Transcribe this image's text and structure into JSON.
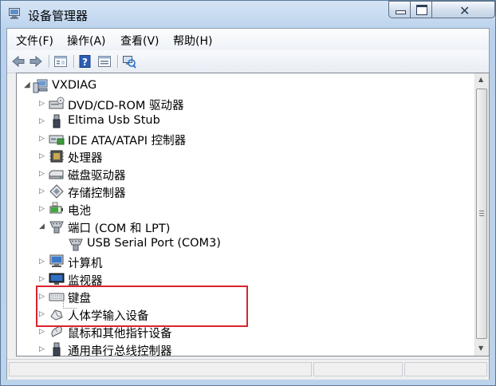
{
  "window": {
    "title": "设备管理器"
  },
  "menubar": {
    "items": [
      "文件(F)",
      "操作(A)",
      "查看(V)",
      "帮助(H)"
    ]
  },
  "toolbar": {
    "buttons": [
      "back-icon",
      "forward-icon",
      "properties-icon",
      "help-icon",
      "details-icon",
      "scan-hardware-icon"
    ]
  },
  "tree": {
    "root": "VXDIAG",
    "items": [
      {
        "label": "DVD/CD-ROM 驱动器",
        "icon": "dvd-drive-icon",
        "expanded": false
      },
      {
        "label": "Eltima Usb Stub",
        "icon": "usb-plug-icon",
        "expanded": false
      },
      {
        "label": "IDE ATA/ATAPI 控制器",
        "icon": "ide-controller-icon",
        "expanded": false
      },
      {
        "label": "处理器",
        "icon": "processor-icon",
        "expanded": false
      },
      {
        "label": "磁盘驱动器",
        "icon": "disk-drive-icon",
        "expanded": false
      },
      {
        "label": "存储控制器",
        "icon": "storage-controller-icon",
        "expanded": false
      },
      {
        "label": "电池",
        "icon": "battery-icon",
        "expanded": false
      },
      {
        "label": "端口 (COM 和 LPT)",
        "icon": "port-icon",
        "expanded": true
      },
      {
        "label": "USB Serial Port (COM3)",
        "icon": "port-icon",
        "child": true
      },
      {
        "label": "计算机",
        "icon": "computer-icon",
        "expanded": false
      },
      {
        "label": "监视器",
        "icon": "monitor-icon",
        "expanded": false
      },
      {
        "label": "键盘",
        "icon": "keyboard-icon",
        "expanded": false
      },
      {
        "label": "人体学输入设备",
        "icon": "hid-icon",
        "expanded": false
      },
      {
        "label": "鼠标和其他指针设备",
        "icon": "mouse-icon",
        "expanded": false
      },
      {
        "label": "通用串行总线控制器",
        "icon": "usb-controller-icon",
        "expanded": false
      }
    ]
  },
  "colors": {
    "highlight_border": "#d9232d",
    "window_frame": "#b9d1ec"
  }
}
